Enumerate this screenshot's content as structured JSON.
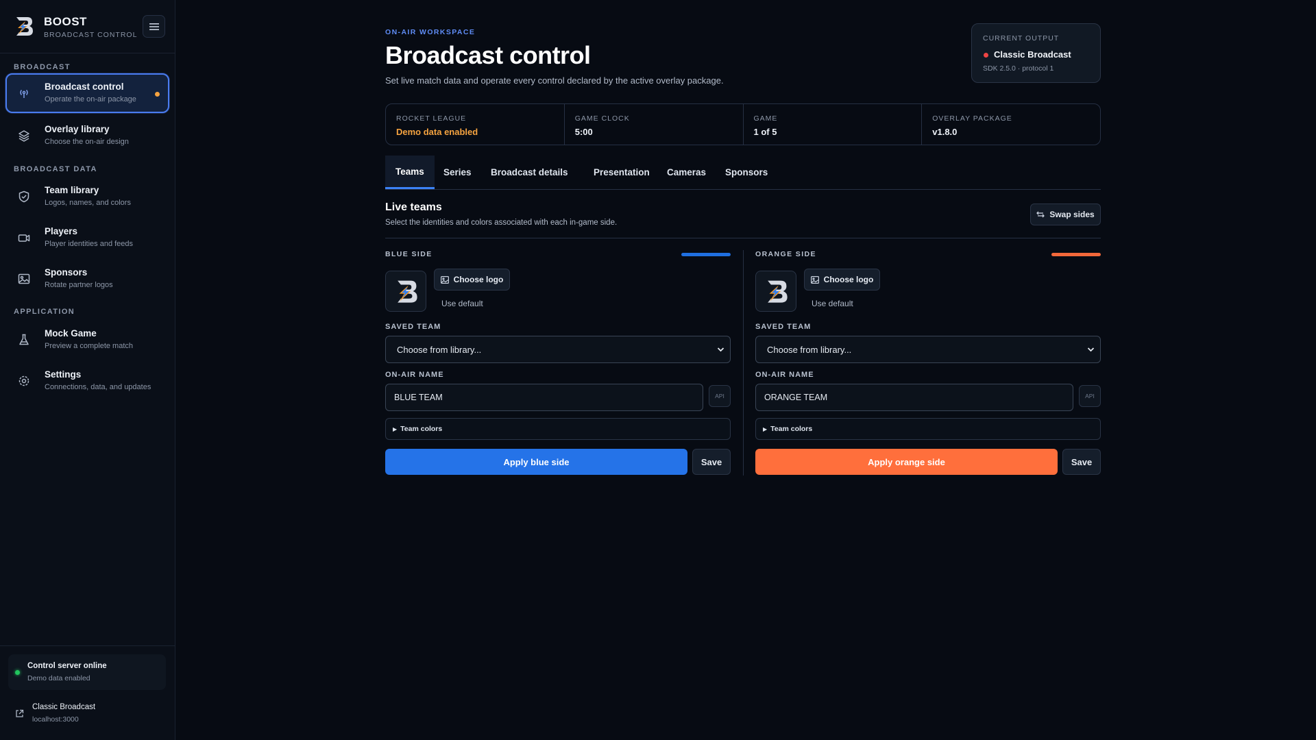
{
  "brand": {
    "name": "BOOST",
    "subtitle": "BROADCAST CONTROL",
    "logo_icon": "boost-logo-icon",
    "menu_icon": "hamburger-icon"
  },
  "sidebar": {
    "sections": [
      {
        "label": "BROADCAST"
      },
      {
        "label": "BROADCAST DATA"
      },
      {
        "label": "APPLICATION"
      }
    ],
    "items": [
      {
        "title": "Broadcast control",
        "subtitle": "Operate the on-air package",
        "icon": "broadcast-icon",
        "active": true
      },
      {
        "title": "Overlay library",
        "subtitle": "Choose the on-air design",
        "icon": "layers-icon"
      },
      {
        "title": "Team library",
        "subtitle": "Logos, names, and colors",
        "icon": "shield-icon"
      },
      {
        "title": "Players",
        "subtitle": "Player identities and feeds",
        "icon": "camera-icon"
      },
      {
        "title": "Sponsors",
        "subtitle": "Rotate partner logos",
        "icon": "image-icon"
      },
      {
        "title": "Mock Game",
        "subtitle": "Preview a complete match",
        "icon": "flask-icon"
      },
      {
        "title": "Settings",
        "subtitle": "Connections, data, and updates",
        "icon": "gear-icon"
      }
    ],
    "status": {
      "title": "Control server online",
      "subtitle": "Demo data enabled",
      "color": "#22c55e"
    },
    "output_link": {
      "title": "Classic Broadcast",
      "subtitle": "localhost:3000",
      "icon": "external-link-icon"
    }
  },
  "header": {
    "eyebrow": "ON-AIR WORKSPACE",
    "title": "Broadcast control",
    "description": "Set live match data and operate every control declared by the active overlay package."
  },
  "current_output": {
    "label": "CURRENT OUTPUT",
    "title": "Classic Broadcast",
    "subtitle": "SDK 2.5.0 · protocol 1",
    "status_color": "#ef4444"
  },
  "stats": [
    {
      "label": "ROCKET LEAGUE",
      "value": "Demo data enabled"
    },
    {
      "label": "GAME CLOCK",
      "value": "5:00"
    },
    {
      "label": "GAME",
      "value": "1 of 5"
    },
    {
      "label": "OVERLAY PACKAGE",
      "value": "v1.8.0"
    }
  ],
  "tabs": [
    {
      "label": "Teams",
      "active": true
    },
    {
      "label": "Series"
    },
    {
      "label": "Broadcast details"
    },
    {
      "label": "Presentation"
    },
    {
      "label": "Cameras"
    },
    {
      "label": "Sponsors"
    }
  ],
  "live_teams": {
    "title": "Live teams",
    "description": "Select the identities and colors associated with each in-game side.",
    "swap_label": "Swap sides",
    "swap_icon": "swap-arrows-icon"
  },
  "blue": {
    "label": "BLUE SIDE",
    "color": "#1f6fe0",
    "choose_logo": "Choose logo",
    "use_default": "Use default",
    "saved_team_label": "SAVED TEAM",
    "saved_team_value": "Choose from library...",
    "name_label": "ON-AIR NAME",
    "name_value": "BLUE TEAM",
    "api_label": "API",
    "colors_label": "Team colors",
    "apply_label": "Apply blue side",
    "save_label": "Save"
  },
  "orange": {
    "label": "ORANGE SIDE",
    "color": "#f2683a",
    "choose_logo": "Choose logo",
    "use_default": "Use default",
    "saved_team_label": "SAVED TEAM",
    "saved_team_value": "Choose from library...",
    "name_label": "ON-AIR NAME",
    "name_value": "ORANGE TEAM",
    "api_label": "API",
    "colors_label": "Team colors",
    "apply_label": "Apply orange side",
    "save_label": "Save"
  }
}
